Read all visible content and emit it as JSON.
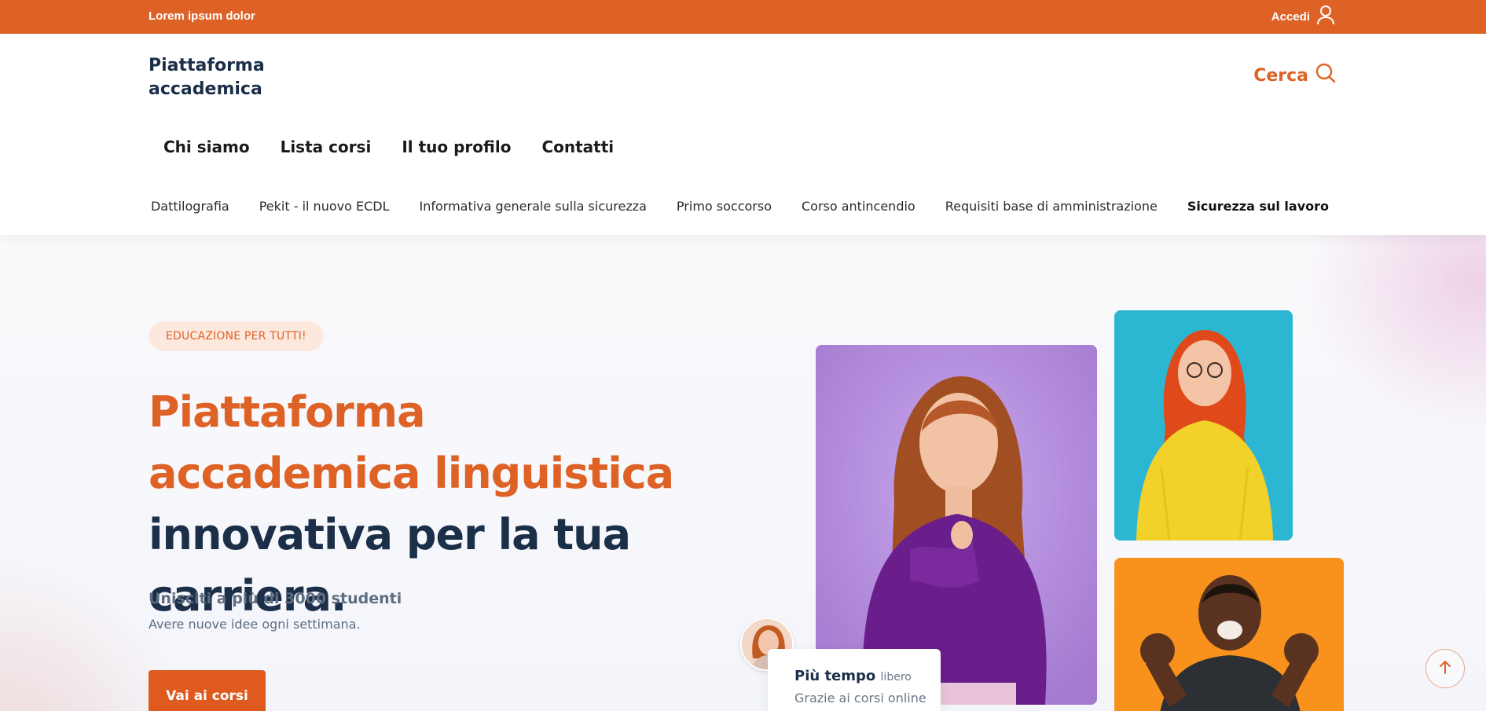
{
  "topbar": {
    "brand": "Lorem ipsum dolor",
    "login_label": "Accedi"
  },
  "header": {
    "logo_line1": "Piattaforma",
    "logo_line2": "accademica",
    "search_label": "Cerca",
    "main_nav": [
      "Chi siamo",
      "Lista corsi",
      "Il tuo profilo",
      "Contatti"
    ],
    "sub_nav": [
      "Dattilografia",
      "Pekit - il nuovo ECDL",
      "Informativa generale sulla sicurezza",
      "Primo soccorso",
      "Corso antincendio",
      "Requisiti base di amministrazione",
      "Sicurezza sul lavoro"
    ]
  },
  "hero": {
    "badge": "EDUCAZIONE PER TUTTI!",
    "headline_accent": "Piattaforma accademica linguistica",
    "headline_rest": "innovativa per la tua carriera.",
    "subtitle": "Unisciti a più di 3000 studenti",
    "subtext": "Avere nuove idee ogni settimana.",
    "cta_label": "Vai ai corsi",
    "card_title": "Più tempo",
    "card_title_small": "libero",
    "card_text": "Grazie ai corsi online"
  },
  "colors": {
    "brand_orange": "#de6226",
    "navy": "#1b2f49"
  },
  "icons": {
    "login": "user-icon",
    "search": "search-icon",
    "scroll_top": "arrow-up-icon"
  }
}
